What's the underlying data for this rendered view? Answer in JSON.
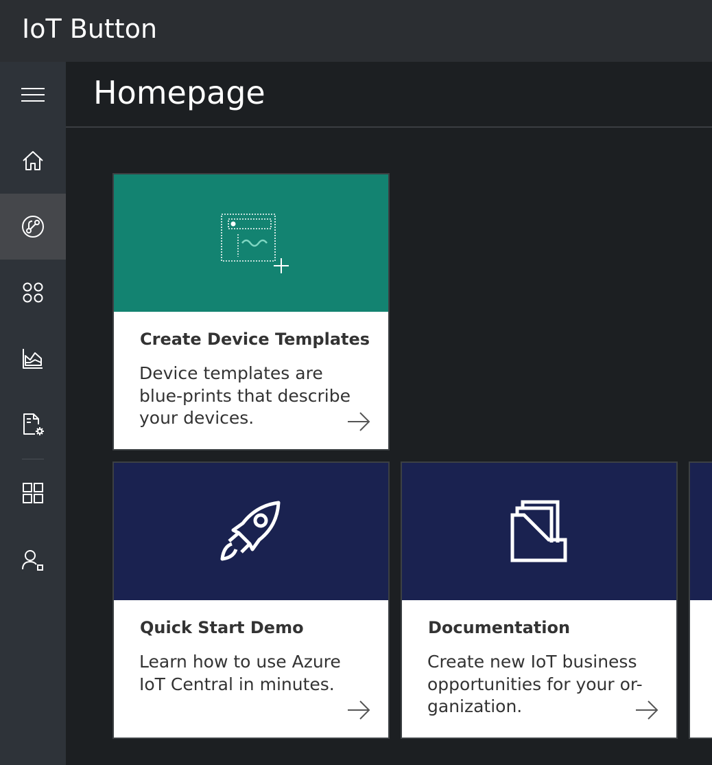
{
  "app": {
    "title": "IoT Button"
  },
  "sidebar": {
    "items": [
      {
        "icon": "hamburger-menu-icon"
      },
      {
        "icon": "home-icon"
      },
      {
        "icon": "device-explorer-icon",
        "active": true
      },
      {
        "icon": "device-sets-icon"
      },
      {
        "icon": "analytics-icon"
      },
      {
        "icon": "jobs-icon"
      },
      {
        "icon": "app-builder-icon"
      },
      {
        "icon": "administration-icon"
      }
    ]
  },
  "page": {
    "title": "Homepage"
  },
  "tiles": [
    {
      "title": "Create Device Templates",
      "description": "Device templates are blue-prints that describe your devices.",
      "color": "#138371",
      "icon": "device-template-icon"
    },
    {
      "title": "Quick Start Demo",
      "description": "Learn how to use Azure IoT Central in minutes.",
      "color": "#1a2250",
      "icon": "rocket-icon"
    },
    {
      "title": "Documentation",
      "description": "Create new IoT business opportunities for your or-ganization.",
      "color": "#1a2250",
      "icon": "documents-icon"
    },
    {
      "color": "#1a2250"
    }
  ]
}
